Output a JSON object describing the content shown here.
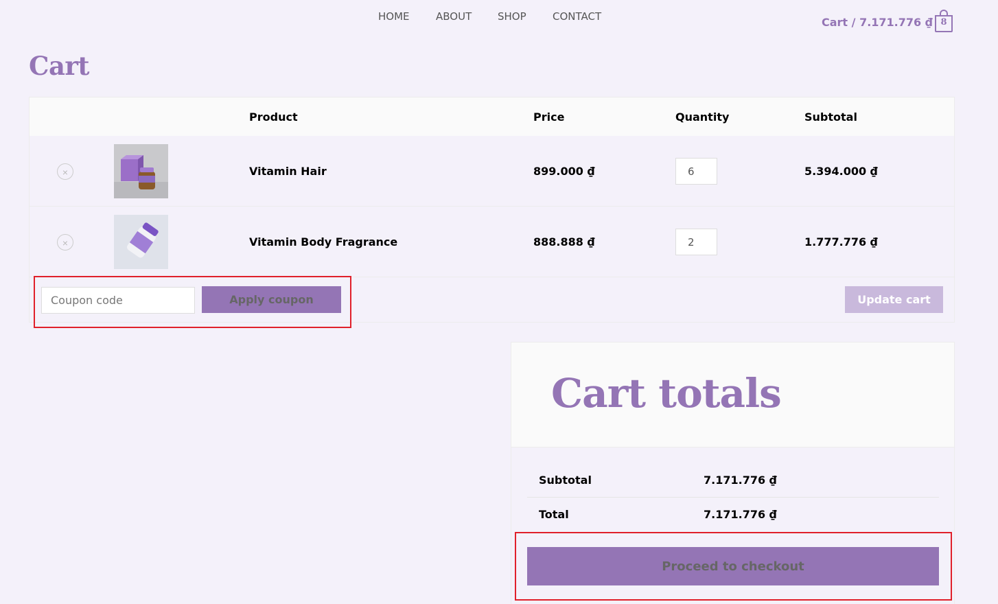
{
  "nav": {
    "items": [
      "HOME",
      "ABOUT",
      "SHOP",
      "CONTACT"
    ],
    "cart_label": "Cart / 7.171.776 ₫",
    "cart_count": "8"
  },
  "page": {
    "title": "Cart"
  },
  "table": {
    "headers": {
      "product": "Product",
      "price": "Price",
      "quantity": "Quantity",
      "subtotal": "Subtotal"
    },
    "rows": [
      {
        "remove": "×",
        "name": "Vitamin Hair",
        "price": "899.000 ₫",
        "quantity": "6",
        "subtotal": "5.394.000 ₫"
      },
      {
        "remove": "×",
        "name": "Vitamin Body Fragrance",
        "price": "888.888 ₫",
        "quantity": "2",
        "subtotal": "1.777.776 ₫"
      }
    ],
    "coupon_placeholder": "Coupon code",
    "apply_label": "Apply coupon",
    "update_label": "Update cart"
  },
  "totals": {
    "title": "Cart totals",
    "subtotal_label": "Subtotal",
    "subtotal_value": "7.171.776 ₫",
    "total_label": "Total",
    "total_value": "7.171.776 ₫",
    "checkout_label": "Proceed to checkout"
  },
  "colors": {
    "accent": "#9475b5",
    "background": "#f4f1fa",
    "highlight": "#e0202a"
  }
}
